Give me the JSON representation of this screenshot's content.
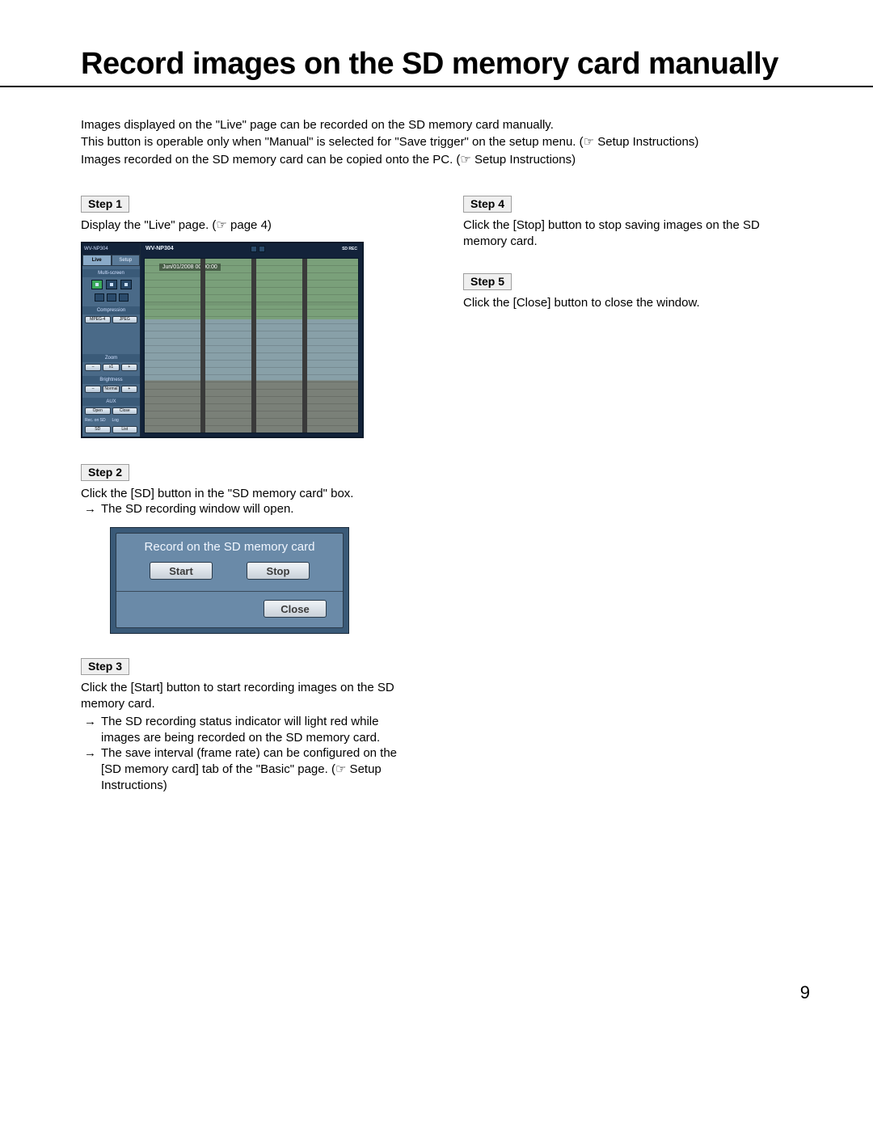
{
  "title": "Record images on the SD memory card manually",
  "intro": {
    "l1": "Images displayed on the \"Live\" page can be recorded on the SD memory card manually.",
    "l2a": "This button is operable only when \"Manual\" is selected for \"Save trigger\" on the setup menu. (",
    "l2b": " Setup Instructions)",
    "l3a": "Images recorded on the SD memory card can be copied onto the PC. (",
    "l3b": " Setup Instructions)"
  },
  "ptr": "☞",
  "left": {
    "step1": {
      "label": "Step 1",
      "body_a": "Display the \"Live\" page. (",
      "body_b": " page 4)"
    },
    "step2": {
      "label": "Step 2",
      "body": "Click the [SD] button in the \"SD memory card\" box.",
      "arrow": "→",
      "sub": "The SD recording window will open."
    },
    "step3": {
      "label": "Step 3",
      "body": "Click the [Start] button to start recording images on the SD memory card.",
      "arrow": "→",
      "sub1": "The SD recording status indicator will light red while images are being recorded on the SD memory card.",
      "sub2a": "The save interval (frame rate) can be configured on the [SD memory card] tab of the \"Basic\" page. (",
      "sub2b": " Setup Instructions)"
    }
  },
  "right": {
    "step4": {
      "label": "Step 4",
      "body": "Click the [Stop] button to stop saving images on the SD memory card."
    },
    "step5": {
      "label": "Step 5",
      "body": "Click the [Close] button to close the window."
    }
  },
  "live_ui": {
    "model": "WV-NP304",
    "tab_live": "Live",
    "tab_setup": "Setup",
    "grp_multi": "Multi-screen",
    "grp_comp": "Compression",
    "btn_mpeg": "MPEG-4",
    "btn_jpeg": "JPEG",
    "grp_zoom": "Zoom",
    "zoom_wide": "–",
    "zoom_x1": "x1",
    "zoom_tele": "+",
    "grp_bright": "Brightness",
    "br_dark": "–",
    "br_norm": "Normal",
    "br_light": "+",
    "grp_aux": "AUX",
    "aux_open": "Open",
    "aux_close": "Close",
    "grp_sd": "Rec. on SD",
    "sd_btn": "SD",
    "grp_log": "Log",
    "log_btn": "List",
    "timestamp": "Jun/01/2008 00:00:00",
    "status_badge": "SD REC"
  },
  "sd_dialog": {
    "title": "Record on the SD memory card",
    "start": "Start",
    "stop": "Stop",
    "close": "Close"
  },
  "page_num": "9"
}
